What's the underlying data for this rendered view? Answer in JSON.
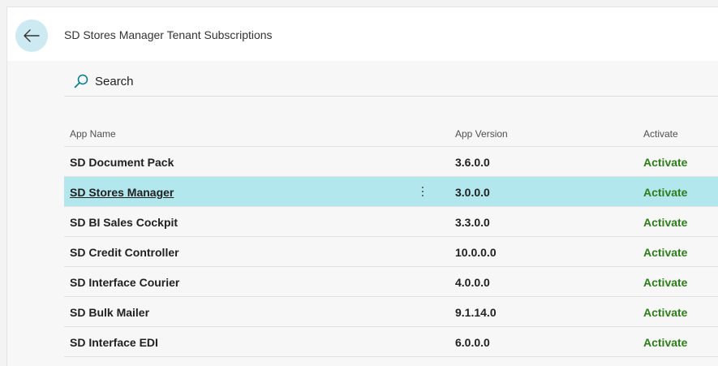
{
  "page": {
    "title": "SD Stores Manager Tenant Subscriptions"
  },
  "search": {
    "label": "Search"
  },
  "table": {
    "columns": {
      "name": "App Name",
      "version": "App Version",
      "activate": "Activate"
    },
    "rows": [
      {
        "name": "SD Document Pack",
        "version": "3.6.0.0",
        "action": "Activate"
      },
      {
        "name": "SD Stores Manager",
        "version": "3.0.0.0",
        "action": "Activate"
      },
      {
        "name": "SD BI Sales Cockpit",
        "version": "3.3.0.0",
        "action": "Activate"
      },
      {
        "name": "SD Credit Controller",
        "version": "10.0.0.0",
        "action": "Activate"
      },
      {
        "name": "SD Interface Courier",
        "version": "4.0.0.0",
        "action": "Activate"
      },
      {
        "name": "SD Bulk Mailer",
        "version": "9.1.14.0",
        "action": "Activate"
      },
      {
        "name": "SD Interface EDI",
        "version": "6.0.0.0",
        "action": "Activate"
      }
    ]
  },
  "colors": {
    "selected_row": "#b1e7ed",
    "activate_link": "#2e7d1b",
    "back_button_bg": "#cdeaf3",
    "accent": "#007a8a"
  },
  "icons": {
    "back": "arrow-left-icon",
    "search": "search-icon",
    "more": "more-vertical-icon"
  }
}
